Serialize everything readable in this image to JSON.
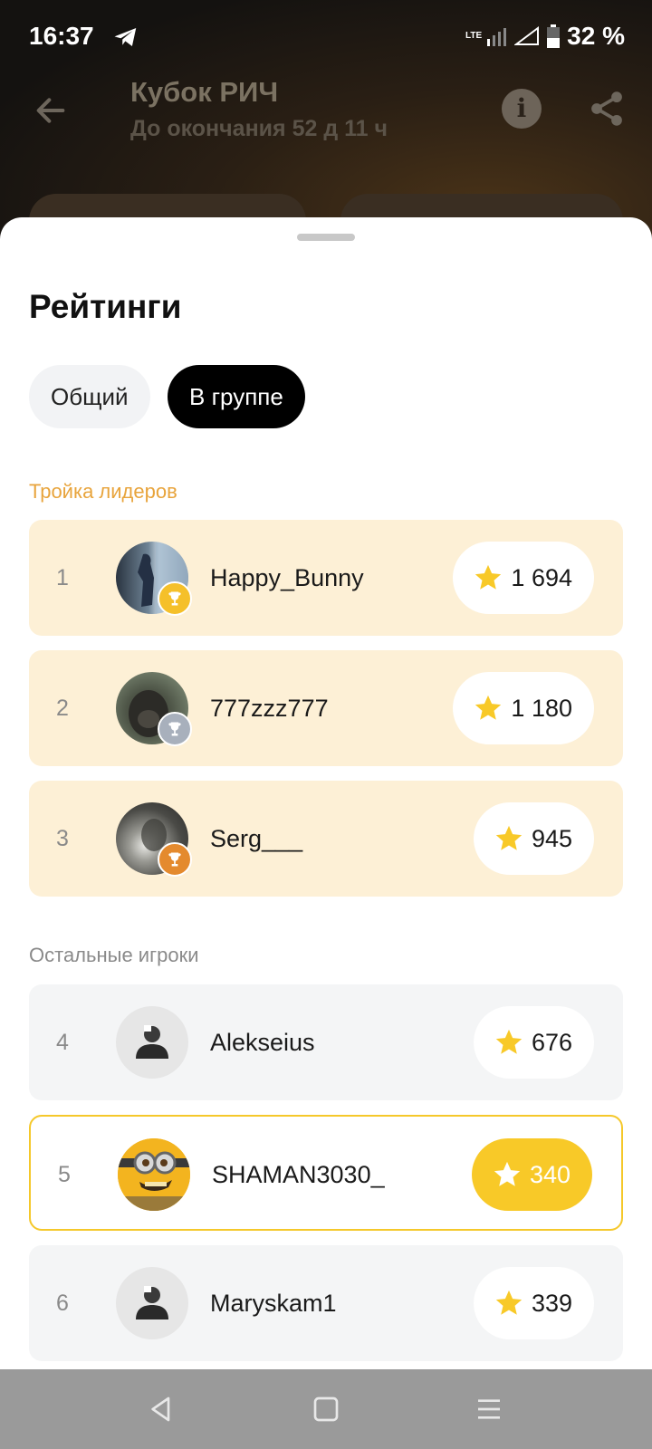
{
  "status_bar": {
    "time": "16:37",
    "network": "LTE",
    "battery": "32 %"
  },
  "header": {
    "title": "Кубок РИЧ",
    "subtitle": "До окончания 52 д 11 ч"
  },
  "sheet": {
    "title": "Рейтинги",
    "tabs": [
      {
        "label": "Общий",
        "active": false
      },
      {
        "label": "В группе",
        "active": true
      }
    ],
    "leaders_label": "Тройка лидеров",
    "others_label": "Остальные игроки",
    "leaders": [
      {
        "rank": "1",
        "name": "Happy_Bunny",
        "score": "1 694",
        "trophy": "gold"
      },
      {
        "rank": "2",
        "name": "777zzz777",
        "score": "1 180",
        "trophy": "silver"
      },
      {
        "rank": "3",
        "name": "Serg___",
        "score": "945",
        "trophy": "bronze"
      }
    ],
    "others": [
      {
        "rank": "4",
        "name": "Alekseius",
        "score": "676",
        "current_user": false
      },
      {
        "rank": "5",
        "name": "SHAMAN3030_",
        "score": "340",
        "current_user": true
      },
      {
        "rank": "6",
        "name": "Maryskam1",
        "score": "339",
        "current_user": false
      }
    ]
  },
  "colors": {
    "accent_yellow": "#F8C928",
    "leader_bg": "#FDF0D6",
    "leaders_label": "#E8A43C",
    "gold": "#F5C02A",
    "silver": "#A8B0BC",
    "bronze": "#E48A2E"
  }
}
